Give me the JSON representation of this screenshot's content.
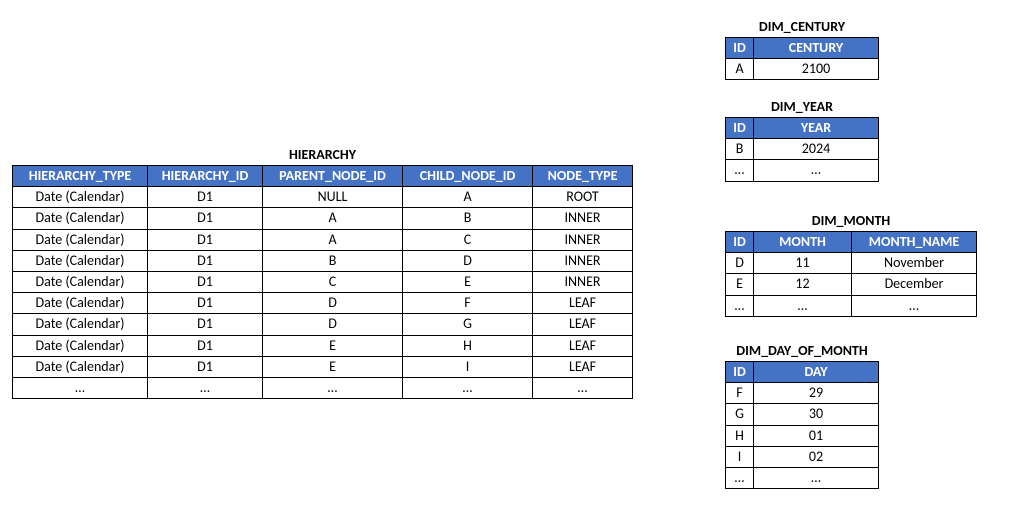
{
  "hierarchy": {
    "title": "HIERARCHY",
    "columns": [
      "HIERARCHY_TYPE",
      "HIERARCHY_ID",
      "PARENT_NODE_ID",
      "CHILD_NODE_ID",
      "NODE_TYPE"
    ],
    "rows": [
      [
        "Date (Calendar)",
        "D1",
        "NULL",
        "A",
        "ROOT"
      ],
      [
        "Date (Calendar)",
        "D1",
        "A",
        "B",
        "INNER"
      ],
      [
        "Date (Calendar)",
        "D1",
        "A",
        "C",
        "INNER"
      ],
      [
        "Date (Calendar)",
        "D1",
        "B",
        "D",
        "INNER"
      ],
      [
        "Date (Calendar)",
        "D1",
        "C",
        "E",
        "INNER"
      ],
      [
        "Date (Calendar)",
        "D1",
        "D",
        "F",
        "LEAF"
      ],
      [
        "Date (Calendar)",
        "D1",
        "D",
        "G",
        "LEAF"
      ],
      [
        "Date (Calendar)",
        "D1",
        "E",
        "H",
        "LEAF"
      ],
      [
        "Date (Calendar)",
        "D1",
        "E",
        "I",
        "LEAF"
      ],
      [
        "…",
        "…",
        "…",
        "…",
        "…"
      ]
    ]
  },
  "century": {
    "title": "DIM_CENTURY",
    "columns": [
      "ID",
      "CENTURY"
    ],
    "rows": [
      [
        "A",
        "2100"
      ]
    ]
  },
  "year": {
    "title": "DIM_YEAR",
    "columns": [
      "ID",
      "YEAR"
    ],
    "rows": [
      [
        "B",
        "2024"
      ],
      [
        "…",
        "…"
      ]
    ]
  },
  "month": {
    "title": "DIM_MONTH",
    "columns": [
      "ID",
      "MONTH",
      "MONTH_NAME"
    ],
    "rows": [
      [
        "D",
        "11",
        "November"
      ],
      [
        "E",
        "12",
        "December"
      ],
      [
        "…",
        "…",
        "…"
      ]
    ]
  },
  "day": {
    "title": "DIM_DAY_OF_MONTH",
    "columns": [
      "ID",
      "DAY"
    ],
    "rows": [
      [
        "F",
        "29"
      ],
      [
        "G",
        "30"
      ],
      [
        "H",
        "01"
      ],
      [
        "I",
        "02"
      ],
      [
        "…",
        "…"
      ]
    ]
  }
}
